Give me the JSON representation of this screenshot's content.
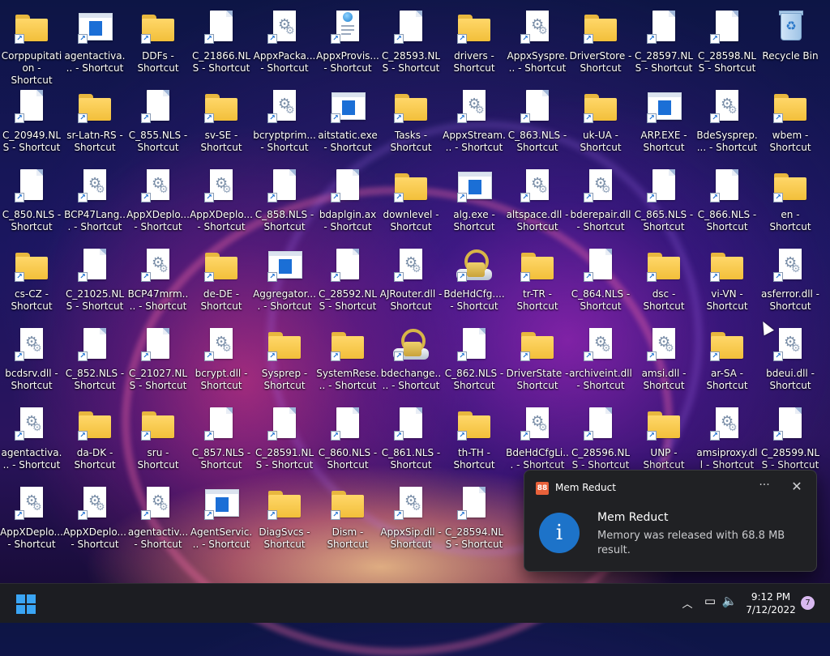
{
  "desktop": {
    "icons": [
      {
        "label": "Corppupitation - Shortcut",
        "type": "folder"
      },
      {
        "label": "agentactiva... - Shortcut",
        "type": "exe"
      },
      {
        "label": "DDFs - Shortcut",
        "type": "folder"
      },
      {
        "label": "C_21866.NLS - Shortcut",
        "type": "file"
      },
      {
        "label": "AppxPacka... - Shortcut",
        "type": "dll"
      },
      {
        "label": "AppxProvis... - Shortcut",
        "type": "xml"
      },
      {
        "label": "C_28593.NLS - Shortcut",
        "type": "file"
      },
      {
        "label": "drivers - Shortcut",
        "type": "folder"
      },
      {
        "label": "AppxSyspre... - Shortcut",
        "type": "dll"
      },
      {
        "label": "DriverStore - Shortcut",
        "type": "folder"
      },
      {
        "label": "C_28597.NLS - Shortcut",
        "type": "file"
      },
      {
        "label": "C_28598.NLS - Shortcut",
        "type": "file"
      },
      {
        "label": "Recycle Bin",
        "type": "recycle"
      },
      {
        "label": "C_20949.NLS - Shortcut",
        "type": "file"
      },
      {
        "label": "sr-Latn-RS - Shortcut",
        "type": "folder"
      },
      {
        "label": "C_855.NLS - Shortcut",
        "type": "file"
      },
      {
        "label": "sv-SE - Shortcut",
        "type": "folder"
      },
      {
        "label": "bcryptprim... - Shortcut",
        "type": "dll"
      },
      {
        "label": "aitstatic.exe - Shortcut",
        "type": "exe"
      },
      {
        "label": "Tasks - Shortcut",
        "type": "folder"
      },
      {
        "label": "AppxStream... - Shortcut",
        "type": "dll"
      },
      {
        "label": "C_863.NLS - Shortcut",
        "type": "file"
      },
      {
        "label": "uk-UA - Shortcut",
        "type": "folder"
      },
      {
        "label": "ARP.EXE - Shortcut",
        "type": "exe"
      },
      {
        "label": "BdeSysprep.... - Shortcut",
        "type": "dll"
      },
      {
        "label": "wbem - Shortcut",
        "type": "folder"
      },
      {
        "label": "C_850.NLS - Shortcut",
        "type": "file"
      },
      {
        "label": "BCP47Lang... - Shortcut",
        "type": "dll"
      },
      {
        "label": "AppXDeplo... - Shortcut",
        "type": "dll"
      },
      {
        "label": "AppXDeplo... - Shortcut",
        "type": "dll"
      },
      {
        "label": "C_858.NLS - Shortcut",
        "type": "file"
      },
      {
        "label": "bdaplgin.ax - Shortcut",
        "type": "file"
      },
      {
        "label": "downlevel - Shortcut",
        "type": "folder"
      },
      {
        "label": "alg.exe - Shortcut",
        "type": "exe"
      },
      {
        "label": "altspace.dll - Shortcut",
        "type": "dll"
      },
      {
        "label": "bderepair.dll - Shortcut",
        "type": "dll"
      },
      {
        "label": "C_865.NLS - Shortcut",
        "type": "file"
      },
      {
        "label": "C_866.NLS - Shortcut",
        "type": "file"
      },
      {
        "label": "en - Shortcut",
        "type": "folder"
      },
      {
        "label": "cs-CZ - Shortcut",
        "type": "folder"
      },
      {
        "label": "C_21025.NLS - Shortcut",
        "type": "file"
      },
      {
        "label": "BCP47mrm.... - Shortcut",
        "type": "dll"
      },
      {
        "label": "de-DE - Shortcut",
        "type": "folder"
      },
      {
        "label": "Aggregator.... - Shortcut",
        "type": "exe"
      },
      {
        "label": "C_28592.NLS - Shortcut",
        "type": "file"
      },
      {
        "label": "AJRouter.dll - Shortcut",
        "type": "dll"
      },
      {
        "label": "BdeHdCfg.... - Shortcut",
        "type": "lock"
      },
      {
        "label": "tr-TR - Shortcut",
        "type": "folder"
      },
      {
        "label": "C_864.NLS - Shortcut",
        "type": "file"
      },
      {
        "label": "dsc - Shortcut",
        "type": "folder"
      },
      {
        "label": "vi-VN - Shortcut",
        "type": "folder"
      },
      {
        "label": "asferror.dll - Shortcut",
        "type": "dll"
      },
      {
        "label": "bcdsrv.dll - Shortcut",
        "type": "dll"
      },
      {
        "label": "C_852.NLS - Shortcut",
        "type": "file"
      },
      {
        "label": "C_21027.NLS - Shortcut",
        "type": "file"
      },
      {
        "label": "bcrypt.dll - Shortcut",
        "type": "dll"
      },
      {
        "label": "Sysprep - Shortcut",
        "type": "folder"
      },
      {
        "label": "SystemRese... - Shortcut",
        "type": "folder"
      },
      {
        "label": "bdechange.... - Shortcut",
        "type": "lock"
      },
      {
        "label": "C_862.NLS - Shortcut",
        "type": "file"
      },
      {
        "label": "DriverState - Shortcut",
        "type": "folder"
      },
      {
        "label": "archiveint.dll - Shortcut",
        "type": "dll"
      },
      {
        "label": "amsi.dll - Shortcut",
        "type": "dll"
      },
      {
        "label": "ar-SA - Shortcut",
        "type": "folder"
      },
      {
        "label": "bdeui.dll - Shortcut",
        "type": "dll"
      },
      {
        "label": "agentactiva... - Shortcut",
        "type": "dll"
      },
      {
        "label": "da-DK - Shortcut",
        "type": "folder"
      },
      {
        "label": "sru - Shortcut",
        "type": "folder"
      },
      {
        "label": "C_857.NLS - Shortcut",
        "type": "file"
      },
      {
        "label": "C_28591.NLS - Shortcut",
        "type": "file"
      },
      {
        "label": "C_860.NLS - Shortcut",
        "type": "file"
      },
      {
        "label": "C_861.NLS - Shortcut",
        "type": "file"
      },
      {
        "label": "th-TH - Shortcut",
        "type": "folder"
      },
      {
        "label": "BdeHdCfgLi... - Shortcut",
        "type": "dll"
      },
      {
        "label": "C_28596.NLS - Shortcut",
        "type": "file"
      },
      {
        "label": "UNP - Shortcut",
        "type": "folder"
      },
      {
        "label": "amsiproxy.dll - Shortcut",
        "type": "dll"
      },
      {
        "label": "C_28599.NLS - Shortcut",
        "type": "file"
      },
      {
        "label": "AppXDeplo... - Shortcut",
        "type": "dll"
      },
      {
        "label": "AppXDeplo... - Shortcut",
        "type": "dll"
      },
      {
        "label": "agentactiv... - Shortcut",
        "type": "dll"
      },
      {
        "label": "AgentServic... - Shortcut",
        "type": "exe"
      },
      {
        "label": "DiagSvcs - Shortcut",
        "type": "folder"
      },
      {
        "label": "Dism - Shortcut",
        "type": "folder"
      },
      {
        "label": "AppxSip.dll - Shortcut",
        "type": "dll"
      },
      {
        "label": "C_28594.NLS - Shortcut",
        "type": "file"
      }
    ]
  },
  "notification": {
    "app_name": "Mem Reduct",
    "app_icon_text": "88",
    "more_glyph": "···",
    "close_glyph": "✕",
    "info_glyph": "i",
    "title": "Mem Reduct",
    "message": "Memory was released with 68.8 MB result.",
    "accent": "#1d73c9"
  },
  "taskbar": {
    "chevron_glyph": "︿",
    "network_glyph": "▭",
    "volume_glyph": "🔈",
    "time": "9:12 PM",
    "date": "7/12/2022",
    "notification_count": "7",
    "start_color": "#3aa5f5"
  }
}
